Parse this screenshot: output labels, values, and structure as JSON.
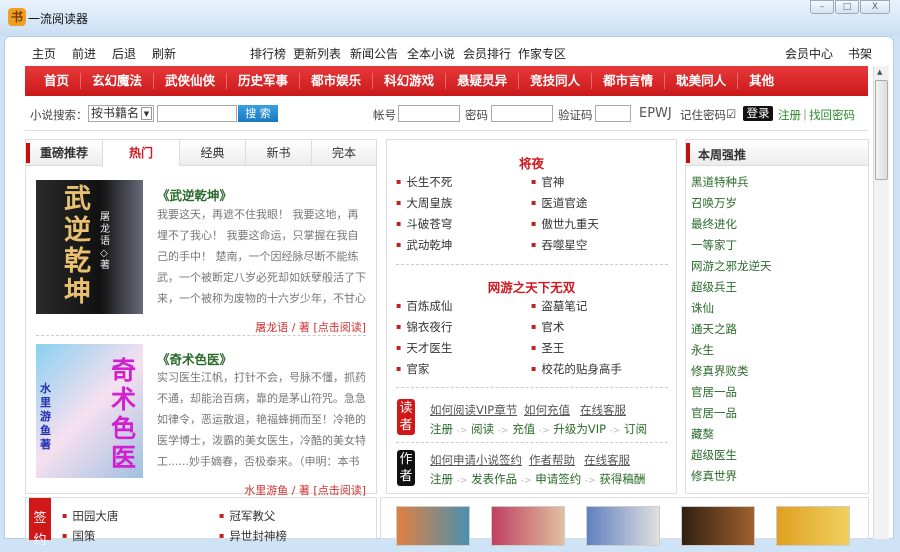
{
  "window": {
    "title": "一流阅读器",
    "logo_glyph": "书",
    "buttons": [
      "–",
      "□",
      "X"
    ]
  },
  "toolbar": {
    "home": "主页",
    "forward": "前进",
    "back": "后退",
    "refresh": "刷新",
    "ranking": "排行榜",
    "updates": "更新列表",
    "news": "新闻公告",
    "complete": "全本小说",
    "member_rank": "会员排行",
    "author_zone": "作家专区",
    "member_center": "会员中心",
    "bookshelf": "书架"
  },
  "nav": [
    "首页",
    "玄幻魔法",
    "武侠仙侠",
    "历史军事",
    "都市娱乐",
    "科幻游戏",
    "悬疑灵异",
    "竞技同人",
    "都市言情",
    "耽美同人",
    "其他"
  ],
  "search": {
    "label": "小说搜索：",
    "select": "按书籍名",
    "button": "搜 索",
    "account": "帐号",
    "password": "密码",
    "captcha_label": "验证码",
    "captcha": "EPWJ",
    "remember": "记住密码",
    "checkbox": "☑",
    "login": "登录",
    "register": "注册",
    "find_pw": "找回密码"
  },
  "left": {
    "heading": "重磅推荐",
    "tabs": [
      "热门",
      "经典",
      "新书",
      "完本"
    ],
    "books": [
      {
        "title": "《武逆乾坤》",
        "desc": "我要这天，再遮不住我眼！ 我要这地，再埋不了我心！ 我要这命运，只掌握在我自己的手中！ 楚南，一个因经脉尽断不能练武，一个被断定八岁必死却如妖孽般活了下来，一个被称为废物的十六岁少年，不甘心被他人瞧不...",
        "author": "屠龙语 / 著",
        "read": "[点击阅读]",
        "cover": "武逆乾坤",
        "cover_author": "屠龙语◇著"
      },
      {
        "title": "《奇术色医》",
        "desc": " 实习医生江帆，打针不会，号脉不懂，抓药不通，却能治百病，靠的是茅山符咒。急急如律令，恶运散退，艳福蜂拥而至！冷艳的医学博士，泼霸的美女医生，冷酷的美女特工......妙手嫡春，否极泰来。（申明：本书中令...",
        "author": "水里游鱼 / 著",
        "read": "[点击阅读]",
        "cover": "奇术色医",
        "cover_author": "水里游鱼著"
      }
    ]
  },
  "middle": {
    "sections": [
      {
        "title": "将夜",
        "items": [
          "长生不死",
          "官神",
          "大周皇族",
          "医道官途",
          "斗破苍穹",
          "傲世九重天",
          "武动乾坤",
          "吞噬星空"
        ]
      },
      {
        "title": "网游之天下无双",
        "items": [
          "百炼成仙",
          "盗墓笔记",
          "锦衣夜行",
          "官术",
          "天才医生",
          "圣王",
          "官家",
          "校花的贴身高手"
        ]
      }
    ],
    "reader": {
      "badge": "读者",
      "links": [
        "如何阅读VIP章节",
        "如何充值",
        "在线客服"
      ],
      "steps": [
        "注册",
        "阅读",
        "充值",
        "升级为VIP",
        "订阅"
      ]
    },
    "author": {
      "badge": "作者",
      "links": [
        "如何申请小说签约",
        "作者帮助",
        "在线客服"
      ],
      "steps": [
        "注册",
        "发表作品",
        "申请签约",
        "获得稿酬"
      ]
    }
  },
  "right": {
    "heading": "本周强推",
    "items": [
      "黑道特种兵",
      "召唤万岁",
      "最终进化",
      "一等家丁",
      "网游之邪龙逆天",
      "超级兵王",
      "诛仙",
      "通天之路",
      "永生",
      "修真界败类",
      "官居一品",
      "官居一品",
      "藏獒",
      "超级医生",
      "修真世界"
    ]
  },
  "bottom": {
    "badge": "签约",
    "items": [
      "田园大唐",
      "冠军教父",
      "国策",
      "异世封神榜"
    ]
  }
}
